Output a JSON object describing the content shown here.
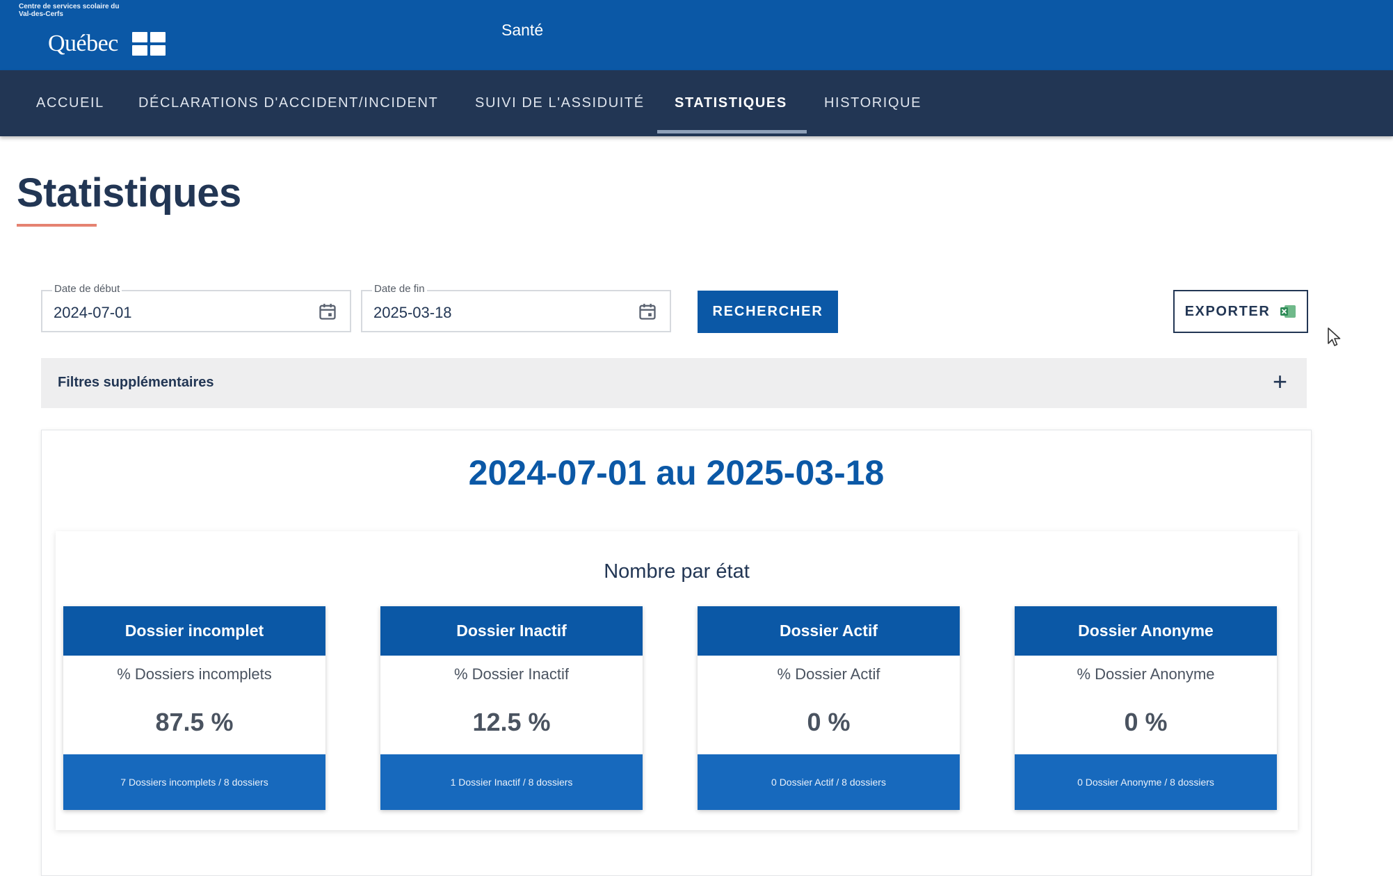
{
  "header": {
    "logo_small_text": "Centre de services scolaire du Val-des-Cerfs",
    "logo_name": "Québec",
    "site_title": "Santé"
  },
  "nav": {
    "items": [
      {
        "label": "ACCUEIL"
      },
      {
        "label": "DÉCLARATIONS D'ACCIDENT/INCIDENT"
      },
      {
        "label": "SUIVI DE L'ASSIDUITÉ"
      },
      {
        "label": "STATISTIQUES",
        "active": true
      },
      {
        "label": "HISTORIQUE"
      }
    ]
  },
  "page": {
    "title": "Statistiques"
  },
  "search": {
    "start_label": "Date de début",
    "start_value": "2024-07-01",
    "end_label": "Date de fin",
    "end_value": "2025-03-18",
    "search_button": "RECHERCHER",
    "export_button": "EXPORTER"
  },
  "filters": {
    "label": "Filtres supplémentaires",
    "toggle": "+"
  },
  "results": {
    "range_title": "2024-07-01 au 2025-03-18",
    "section_title": "Nombre par état",
    "cards": [
      {
        "title": "Dossier incomplet",
        "subtitle": "% Dossiers incomplets",
        "value": "87.5 %",
        "footer": "7 Dossiers incomplets / 8 dossiers"
      },
      {
        "title": "Dossier Inactif",
        "subtitle": "% Dossier Inactif",
        "value": "12.5 %",
        "footer": "1 Dossier Inactif / 8 dossiers"
      },
      {
        "title": "Dossier Actif",
        "subtitle": "% Dossier Actif",
        "value": "0 %",
        "footer": "0 Dossier Actif / 8 dossiers"
      },
      {
        "title": "Dossier Anonyme",
        "subtitle": "% Dossier Anonyme",
        "value": "0 %",
        "footer": "0 Dossier Anonyme / 8 dossiers"
      }
    ]
  },
  "colors": {
    "brand_blue": "#0b58a6",
    "nav_dark": "#223654",
    "accent_red": "#e58271",
    "card_footer_blue": "#1769bd"
  },
  "icons": {
    "calendar": "calendar-icon",
    "excel": "excel-icon",
    "plus": "plus-icon",
    "cursor": "mouse-cursor-icon"
  }
}
